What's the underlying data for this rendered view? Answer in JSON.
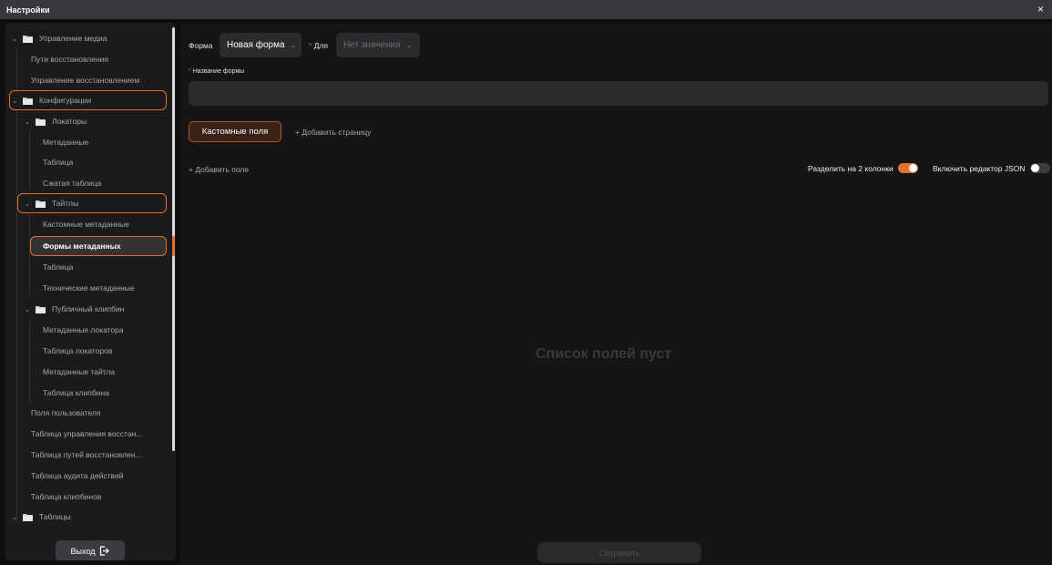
{
  "window": {
    "title": "Настройки",
    "close_glyph": "×"
  },
  "sidebar": {
    "items": [
      {
        "label": "Управление медиа",
        "kind": "folder"
      },
      {
        "label": "Пути восстановления",
        "kind": "leaf"
      },
      {
        "label": "Управление восстановлением",
        "kind": "leaf"
      },
      {
        "label": "Конфигурации",
        "kind": "folder",
        "highlighted": true
      },
      {
        "label": "Локаторы",
        "kind": "folder"
      },
      {
        "label": "Метаданные",
        "kind": "leaf"
      },
      {
        "label": "Таблица",
        "kind": "leaf"
      },
      {
        "label": "Сжатая таблица",
        "kind": "leaf"
      },
      {
        "label": "Тайтлы",
        "kind": "folder",
        "highlighted": true
      },
      {
        "label": "Кастомные метаданные",
        "kind": "leaf"
      },
      {
        "label": "Формы метаданных",
        "kind": "leaf",
        "selected": true
      },
      {
        "label": "Таблица",
        "kind": "leaf"
      },
      {
        "label": "Технические метаданные",
        "kind": "leaf"
      },
      {
        "label": "Публичный клипбин",
        "kind": "folder"
      },
      {
        "label": "Метаданные локатора",
        "kind": "leaf"
      },
      {
        "label": "Таблица локаторов",
        "kind": "leaf"
      },
      {
        "label": "Метаданные тайтла",
        "kind": "leaf"
      },
      {
        "label": "Таблица клипбина",
        "kind": "leaf"
      },
      {
        "label": "Поля пользователя",
        "kind": "leaf"
      },
      {
        "label": "Таблица управления восстан...",
        "kind": "leaf"
      },
      {
        "label": "Таблица путей восстановлен...",
        "kind": "leaf"
      },
      {
        "label": "Таблица аудита действий",
        "kind": "leaf"
      },
      {
        "label": "Таблица клипбинов",
        "kind": "leaf"
      },
      {
        "label": "Таблицы",
        "kind": "folder"
      }
    ],
    "exit_label": "Выход"
  },
  "form": {
    "form_label": "Форма",
    "form_value": "Новая форма",
    "for_label": "Для",
    "for_value": "Нет значения",
    "name_label": "Название формы",
    "name_value": ""
  },
  "tabs": {
    "active_label": "Кастомные поля",
    "add_page_label": "+ Добавить страницу"
  },
  "fields": {
    "add_field_label": "+ Добавить поле",
    "split_label": "Разделить на 2 колонки",
    "split_on": true,
    "json_label": "Включить редактор JSON",
    "json_on": false,
    "empty_text": "Список полей пуст"
  },
  "footer": {
    "save_label": "Сохранить"
  },
  "colors": {
    "accent": "#e2722b",
    "required": "#e14a3a"
  }
}
